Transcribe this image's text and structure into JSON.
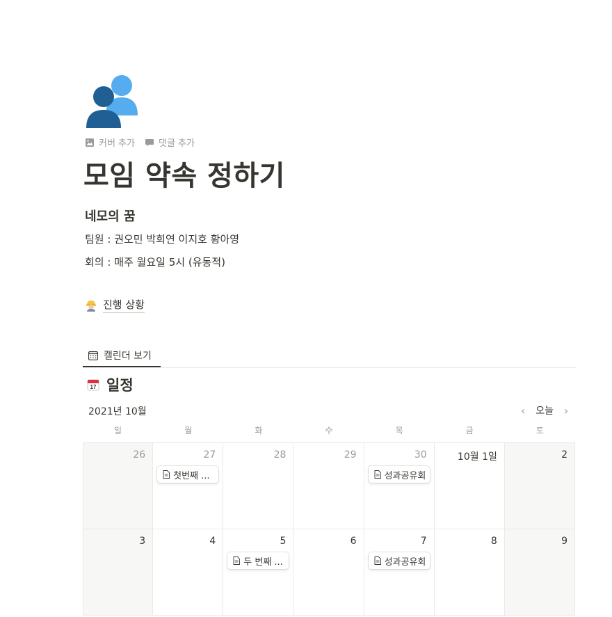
{
  "page": {
    "icon": "people-silhouette-icon",
    "actions": [
      {
        "icon": "image-icon",
        "label": "커버 추가"
      },
      {
        "icon": "comment-icon",
        "label": "댓글 추가"
      }
    ],
    "title": "모임 약속 정하기",
    "subheading": "네모의 꿈",
    "lines": [
      "팀원 : 권오민 박희연 이지호 황아영",
      "회의 : 매주 월요일 5시 (유동적)"
    ],
    "link": {
      "icon": "construction-worker-icon",
      "label": "진행 상황"
    }
  },
  "database": {
    "view_tab": {
      "icon": "calendar-view-icon",
      "label": "캘린더 보기"
    },
    "title": "일정",
    "title_icon": "calendar-17-icon",
    "month": "2021년 10월",
    "today": "오늘",
    "weekdays": [
      "일",
      "월",
      "화",
      "수",
      "목",
      "금",
      "토"
    ],
    "weeks": [
      [
        {
          "day": "26",
          "faded": true
        },
        {
          "day": "27",
          "faded": true,
          "event": "첫번째 ..."
        },
        {
          "day": "28",
          "faded": true
        },
        {
          "day": "29",
          "faded": true
        },
        {
          "day": "30",
          "faded": true,
          "event": "성과공유회"
        },
        {
          "day": "10월 1일",
          "faded": false
        },
        {
          "day": "2",
          "faded": false
        }
      ],
      [
        {
          "day": "3",
          "faded": false
        },
        {
          "day": "4",
          "faded": false
        },
        {
          "day": "5",
          "faded": false,
          "event": "두 번째 ..."
        },
        {
          "day": "6",
          "faded": false
        },
        {
          "day": "7",
          "faded": false,
          "event": "성과공유회"
        },
        {
          "day": "8",
          "faded": false
        },
        {
          "day": "9",
          "faded": false
        }
      ]
    ]
  },
  "colors": {
    "text": "#37352f",
    "muted": "#9b9a97",
    "border": "#e9e9e7",
    "weekend_bg": "#f7f7f5",
    "icon_dark_blue": "#1f5f94",
    "icon_light_blue": "#55acee"
  }
}
